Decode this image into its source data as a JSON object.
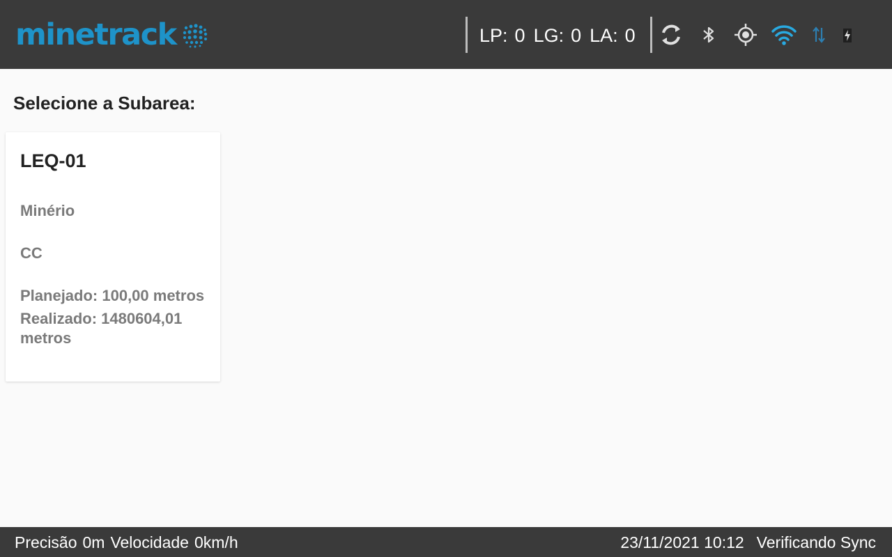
{
  "header": {
    "logo_text": "minetrack",
    "counters": [
      {
        "label": "LP:",
        "value": "0"
      },
      {
        "label": "LG:",
        "value": "0"
      },
      {
        "label": "LA:",
        "value": "0"
      }
    ],
    "icons": [
      "sync-icon",
      "bluetooth-icon",
      "gps-icon",
      "wifi-icon",
      "data-transfer-icon",
      "battery-charging-icon"
    ],
    "colors": {
      "bar": "#3a3a3a",
      "logo": "#1e93c9",
      "wifi": "#29a9e0"
    }
  },
  "main": {
    "title": "Selecione a Subarea:",
    "cards": [
      {
        "name": "LEQ-01",
        "material": "Minério",
        "type": "CC",
        "planejado": "Planejado: 100,00 metros",
        "realizado": "Realizado: 1480604,01 metros"
      }
    ]
  },
  "footer": {
    "precisao_label": "Precisão",
    "precisao_value": "0m",
    "velocidade_label": "Velocidade",
    "velocidade_value": "0km/h",
    "datetime": "23/11/2021 10:12",
    "sync_status": "Verificando Sync"
  }
}
